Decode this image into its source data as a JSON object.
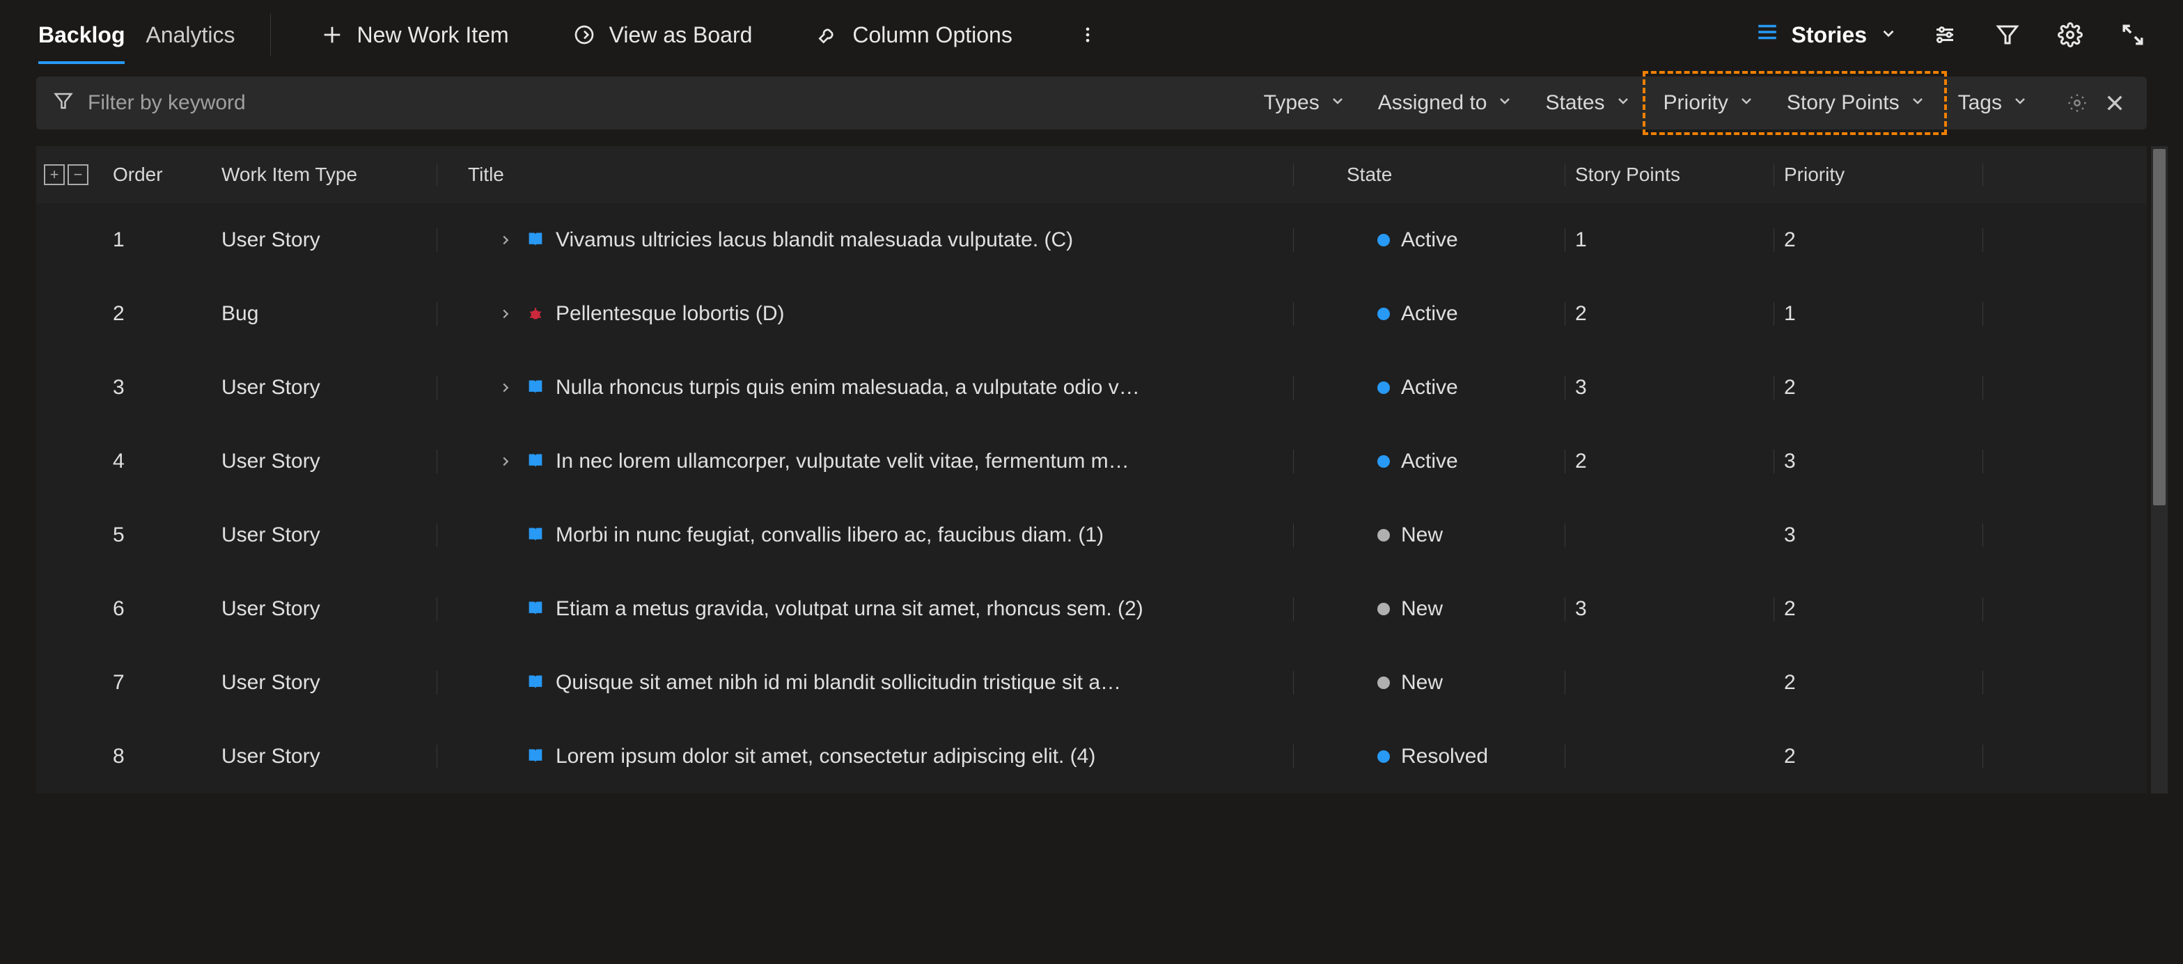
{
  "tabs": {
    "backlog": "Backlog",
    "analytics": "Analytics"
  },
  "toolbar": {
    "new_work_item": "New Work Item",
    "view_as_board": "View as Board",
    "column_options": "Column Options",
    "stories": "Stories"
  },
  "filter_bar": {
    "placeholder": "Filter by keyword",
    "types": "Types",
    "assigned_to": "Assigned to",
    "states": "States",
    "priority": "Priority",
    "story_points": "Story Points",
    "tags": "Tags"
  },
  "columns": {
    "order": "Order",
    "work_item_type": "Work Item Type",
    "title": "Title",
    "state": "State",
    "story_points": "Story Points",
    "priority": "Priority"
  },
  "state_colors": {
    "Active": "#2899f5",
    "New": "#b0b0b0",
    "Resolved": "#2899f5"
  },
  "type_icons": {
    "User Story": "book",
    "Bug": "bug"
  },
  "rows": [
    {
      "order": "1",
      "type": "User Story",
      "expandable": true,
      "title": "Vivamus ultricies lacus blandit malesuada vulputate. (C)",
      "state": "Active",
      "points": "1",
      "priority": "2"
    },
    {
      "order": "2",
      "type": "Bug",
      "expandable": true,
      "title": "Pellentesque lobortis (D)",
      "state": "Active",
      "points": "2",
      "priority": "1"
    },
    {
      "order": "3",
      "type": "User Story",
      "expandable": true,
      "title": "Nulla rhoncus turpis quis enim malesuada, a vulputate odio v…",
      "state": "Active",
      "points": "3",
      "priority": "2"
    },
    {
      "order": "4",
      "type": "User Story",
      "expandable": true,
      "title": "In nec lorem ullamcorper, vulputate velit vitae, fermentum m…",
      "state": "Active",
      "points": "2",
      "priority": "3"
    },
    {
      "order": "5",
      "type": "User Story",
      "expandable": false,
      "title": "Morbi in nunc feugiat, convallis libero ac, faucibus diam. (1)",
      "state": "New",
      "points": "",
      "priority": "3"
    },
    {
      "order": "6",
      "type": "User Story",
      "expandable": false,
      "title": "Etiam a metus gravida, volutpat urna sit amet, rhoncus sem. (2)",
      "state": "New",
      "points": "3",
      "priority": "2"
    },
    {
      "order": "7",
      "type": "User Story",
      "expandable": false,
      "title": "Quisque sit amet nibh id mi blandit sollicitudin tristique sit a…",
      "state": "New",
      "points": "",
      "priority": "2"
    },
    {
      "order": "8",
      "type": "User Story",
      "expandable": false,
      "title": "Lorem ipsum dolor sit amet, consectetur adipiscing elit. (4)",
      "state": "Resolved",
      "points": "",
      "priority": "2"
    }
  ]
}
